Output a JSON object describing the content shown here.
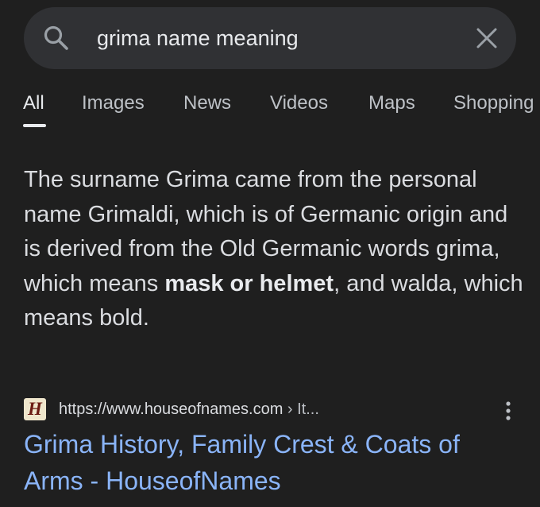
{
  "search": {
    "query": "grima name meaning",
    "icon": "search-icon",
    "clear_icon": "close-icon"
  },
  "tabs": [
    {
      "label": "All",
      "active": true
    },
    {
      "label": "Images"
    },
    {
      "label": "News"
    },
    {
      "label": "Videos"
    },
    {
      "label": "Maps"
    },
    {
      "label": "Shopping"
    }
  ],
  "snippet": {
    "text_before": "The surname Grima came from the personal name Grimaldi, which is of Germanic origin and is derived from the Old Germanic words grima, which means ",
    "bold": "mask or helmet",
    "text_after": ", and walda, which means bold."
  },
  "result": {
    "favicon_letter": "H",
    "url": "https://www.houseofnames.com",
    "breadcrumb": " › It...",
    "title": "Grima History, Family Crest & Coats of Arms - HouseofNames",
    "more_icon": "more-vert-icon"
  },
  "colors": {
    "background": "#1f1f1f",
    "search_bar": "#303134",
    "link": "#8ab4f8",
    "text": "#e8eaed"
  }
}
